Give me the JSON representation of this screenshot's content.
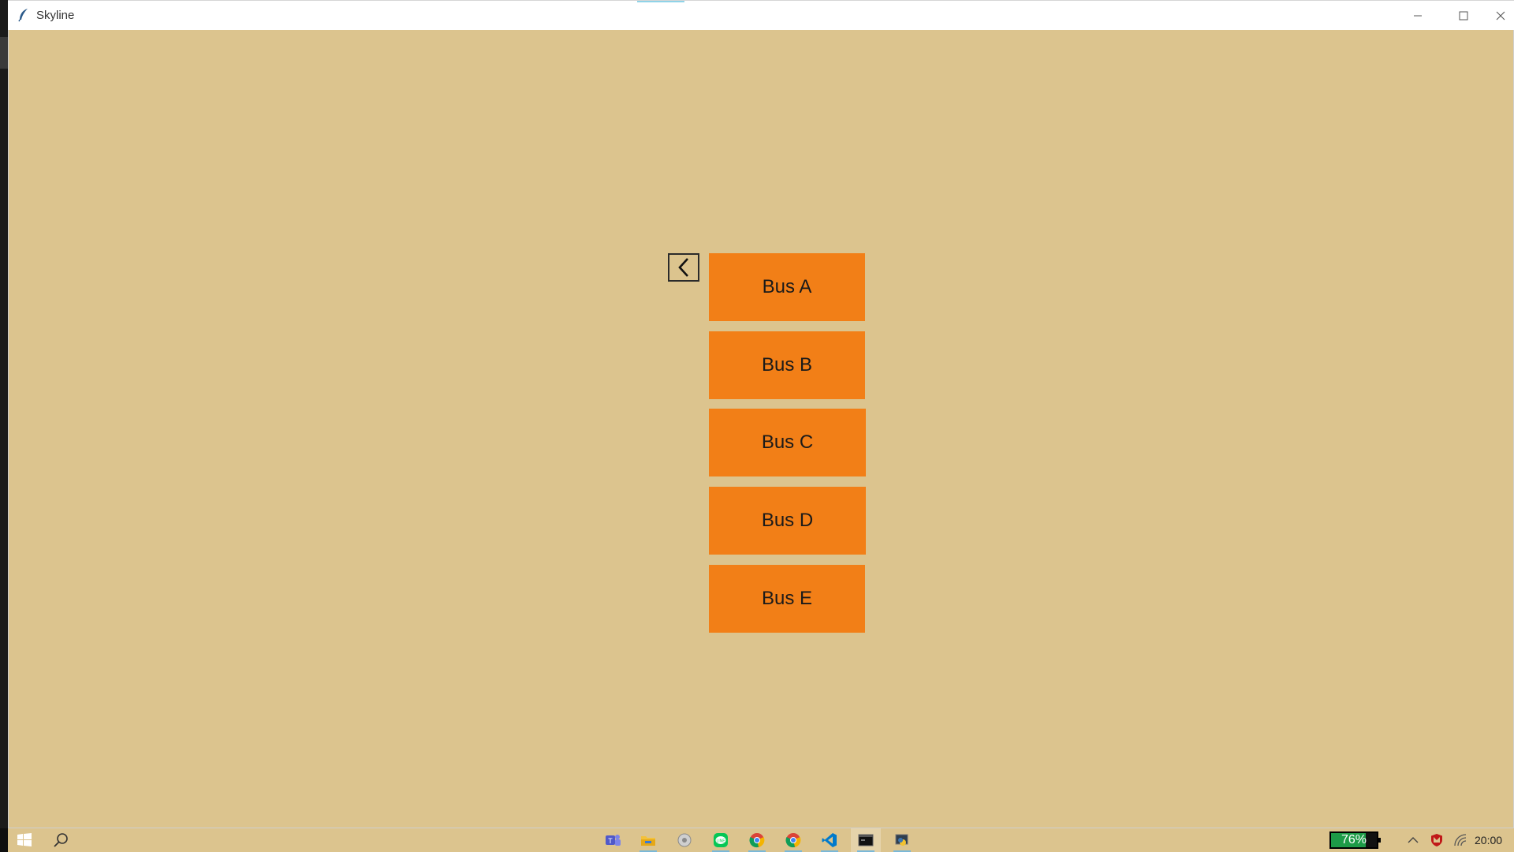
{
  "window": {
    "title": "Skyline"
  },
  "content": {
    "bus_buttons": [
      {
        "label": "Bus A"
      },
      {
        "label": "Bus B"
      },
      {
        "label": "Bus C"
      },
      {
        "label": "Bus D"
      },
      {
        "label": "Bus E"
      }
    ]
  },
  "taskbar": {
    "pinned_icons": [
      "windows-start-icon",
      "search-icon",
      "teams-icon",
      "file-explorer-icon",
      "settings-app-icon",
      "line-icon",
      "chrome-icon",
      "chrome-icon",
      "vscode-icon",
      "terminal-icon",
      "python-icon"
    ],
    "battery": {
      "label": "76%",
      "level": 0.76
    },
    "clock": "20:00"
  },
  "colors": {
    "background": "#DCC48E",
    "button": "#F27F17",
    "battery_fill": "#1d9b47"
  }
}
